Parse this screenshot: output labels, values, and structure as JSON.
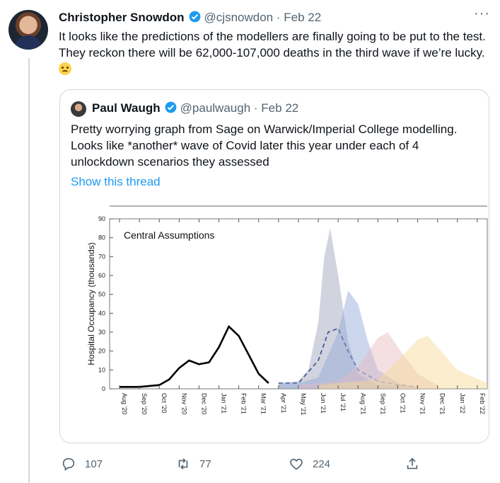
{
  "tweet": {
    "author_name": "Christopher Snowdon",
    "author_handle": "@cjsnowdon",
    "separator": "·",
    "date": "Feb 22",
    "more_label": "···",
    "text": "It looks like the predictions of the modellers are finally going to be put to the test. They reckon there will be 62,000-107,000 deaths in the third wave if we’re lucky.",
    "emoji_icon": "woozy-face-emoji"
  },
  "quoted": {
    "author_name": "Paul Waugh",
    "author_handle": "@paulwaugh",
    "separator": "·",
    "date": "Feb 22",
    "text": "Pretty worrying graph from Sage on Warwick/Imperial College modelling. Looks like *another* wave of Covid later this year under each of 4 unlockdown scenarios they assessed",
    "show_thread": "Show this thread"
  },
  "chart_data": {
    "type": "line",
    "title": "Central Assumptions",
    "ylabel": "Hospital Occupancy (thousands)",
    "xlabel": "",
    "ylim": [
      0,
      90
    ],
    "yticks": [
      0,
      10,
      20,
      30,
      40,
      50,
      60,
      70,
      80,
      90
    ],
    "x_categories": [
      "Aug '20",
      "Sep '20",
      "Oct '20",
      "Nov '20",
      "Dec '20",
      "Jan '21",
      "Feb '21",
      "Mar '21",
      "Apr '21",
      "May '21",
      "Jun '21",
      "Jul '21",
      "Aug '21",
      "Sep '21",
      "Oct '21",
      "Nov '21",
      "Dec '21",
      "Jan '22",
      "Feb '22"
    ],
    "series": [
      {
        "name": "",
        "color": "#000000",
        "style": "solid",
        "x": [
          0,
          1,
          2,
          2.5,
          3,
          3.5,
          4,
          4.5,
          5,
          5.5,
          6,
          6.5,
          7,
          7.5
        ],
        "values": [
          1,
          1,
          2,
          5,
          11,
          15,
          13,
          14,
          22,
          33,
          28,
          18,
          8,
          3
        ]
      },
      {
        "name": "",
        "color": "#9aa0b8",
        "style": "band",
        "x": [
          8,
          9,
          9.5,
          10,
          10.3,
          10.6,
          11,
          11.5,
          12,
          13,
          14
        ],
        "values": [
          3,
          4,
          10,
          35,
          70,
          85,
          60,
          25,
          8,
          2,
          1
        ]
      },
      {
        "name": "",
        "color": "#4a5a9a",
        "style": "dashed",
        "x": [
          8,
          9,
          10,
          10.5,
          11,
          11.5,
          12,
          13,
          14,
          15
        ],
        "values": [
          3,
          3,
          15,
          30,
          32,
          20,
          10,
          4,
          2,
          1
        ]
      },
      {
        "name": "",
        "color": "#8fa6d8",
        "style": "band",
        "x": [
          8,
          9,
          10,
          11,
          11.5,
          12,
          12.5,
          13,
          14,
          15
        ],
        "values": [
          3,
          3,
          6,
          30,
          52,
          45,
          25,
          10,
          3,
          1
        ]
      },
      {
        "name": "",
        "color": "#e7b7c0",
        "style": "band",
        "x": [
          9,
          11,
          12,
          13,
          13.5,
          14,
          15,
          16
        ],
        "values": [
          2,
          4,
          12,
          27,
          30,
          22,
          8,
          2
        ]
      },
      {
        "name": "",
        "color": "#f4d992",
        "style": "band",
        "x": [
          10,
          13,
          14,
          15,
          15.5,
          16,
          17,
          18.5
        ],
        "values": [
          2,
          5,
          15,
          26,
          28,
          22,
          10,
          3
        ]
      }
    ]
  },
  "actions": {
    "reply_count": "107",
    "retweet_count": "77",
    "like_count": "224"
  },
  "colors": {
    "link": "#1d9bf0",
    "secondary": "#536471",
    "verified": "#1d9bf0"
  }
}
